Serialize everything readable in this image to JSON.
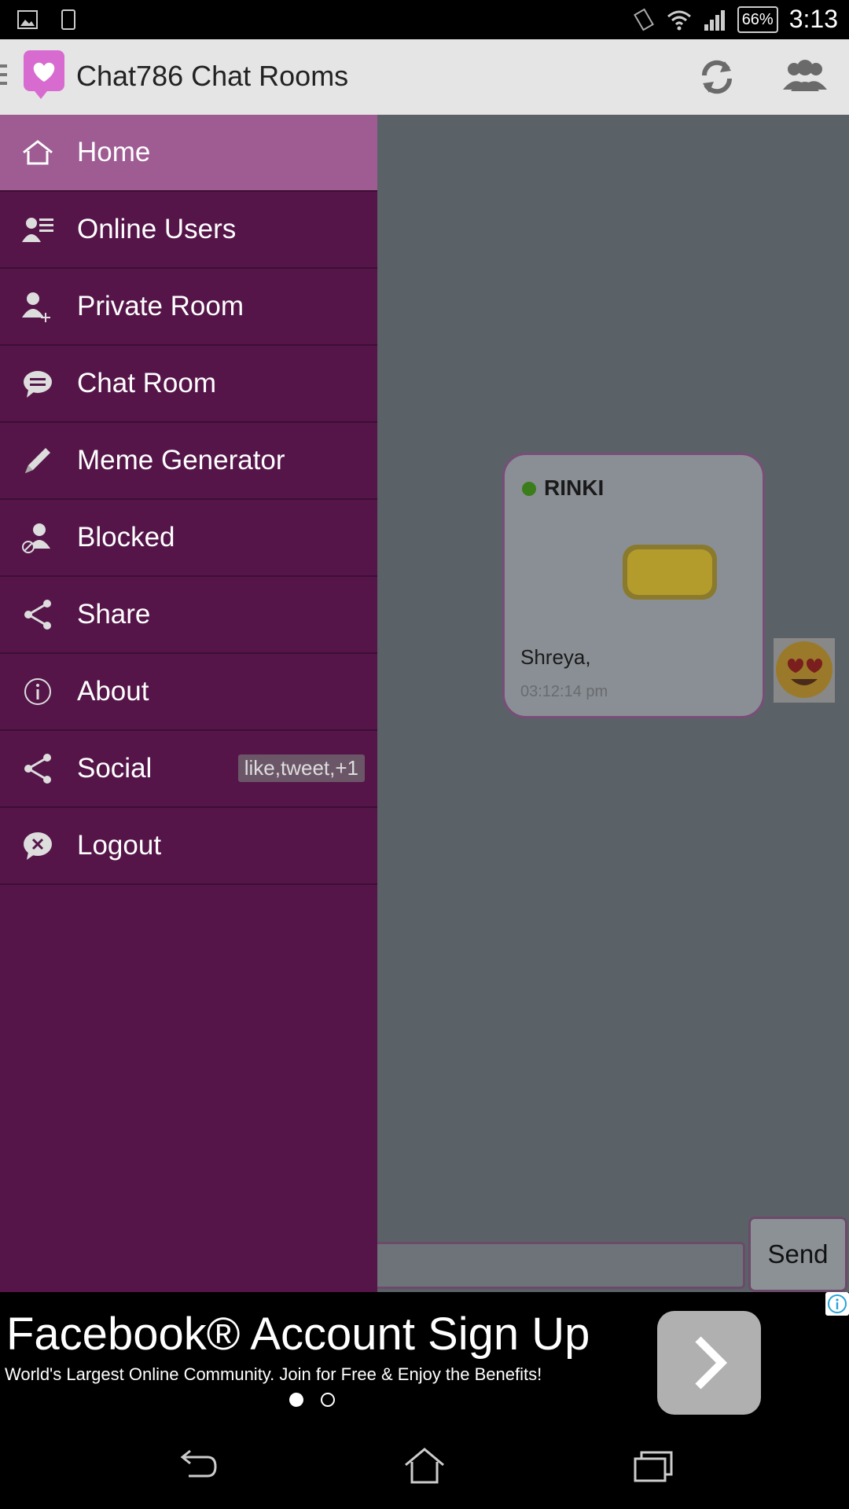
{
  "status_bar": {
    "battery": "66%",
    "time": "3:13"
  },
  "app_bar": {
    "title": "Chat786 Chat Rooms"
  },
  "drawer": {
    "items": [
      {
        "label": "Home",
        "icon": "home-icon"
      },
      {
        "label": "Online Users",
        "icon": "online-users-icon"
      },
      {
        "label": "Private Room",
        "icon": "add-user-icon"
      },
      {
        "label": "Chat Room",
        "icon": "chat-bubble-icon"
      },
      {
        "label": "Meme Generator",
        "icon": "pencil-icon"
      },
      {
        "label": "Blocked",
        "icon": "blocked-user-icon"
      },
      {
        "label": "Share",
        "icon": "share-icon"
      },
      {
        "label": "About",
        "icon": "info-icon"
      },
      {
        "label": "Social",
        "icon": "share-icon",
        "badge": "like,tweet,+1"
      },
      {
        "label": "Logout",
        "icon": "logout-icon"
      }
    ]
  },
  "chat": {
    "message": {
      "user": "RINKI",
      "text": "Shreya,",
      "time": "03:12:14 pm"
    },
    "send_label": "Send"
  },
  "ad": {
    "headline": "Facebook® Account Sign Up",
    "subtext": "World's Largest Online Community. Join for Free & Enjoy the Benefits!"
  },
  "colors": {
    "drawer_bg": "#551549",
    "drawer_active": "#9e5c93",
    "app_bar_bg": "#e5e5e5",
    "chat_bg": "#5a6268"
  }
}
